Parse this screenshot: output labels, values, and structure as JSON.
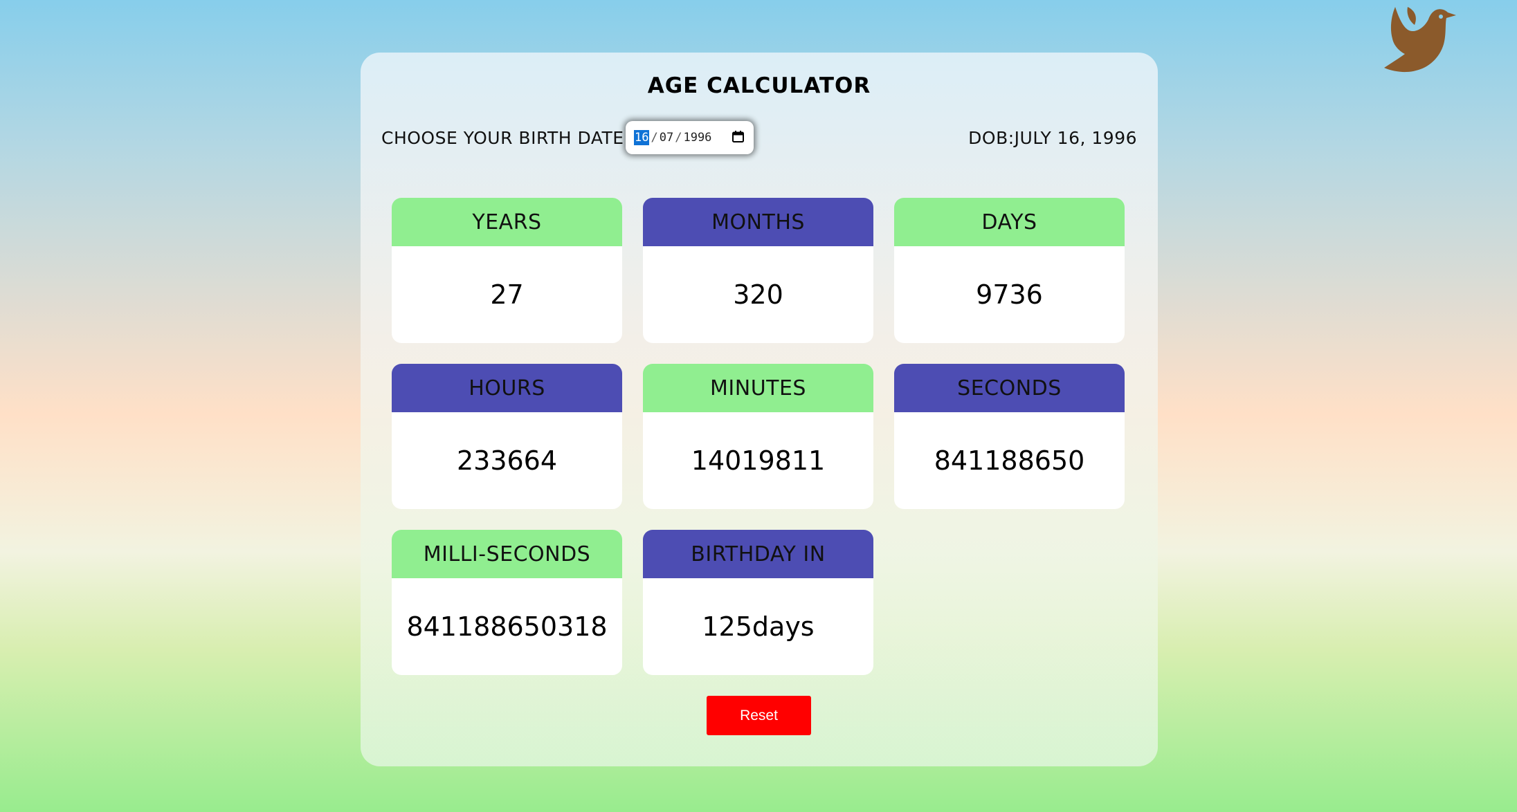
{
  "app": {
    "title": "AGE CALCULATOR"
  },
  "birth_input": {
    "label": "CHOOSE YOUR BIRTH DATE",
    "day": "16",
    "month": "07",
    "year": "1996",
    "separator": "/",
    "icon": "calendar-icon"
  },
  "dob": {
    "text": "DOB:JULY 16, 1996"
  },
  "tiles": [
    {
      "label": "YEARS",
      "value": "27",
      "color": "#90ee90"
    },
    {
      "label": "MONTHS",
      "value": "320",
      "color": "#4d4db3"
    },
    {
      "label": "DAYS",
      "value": "9736",
      "color": "#90ee90"
    },
    {
      "label": "HOURS",
      "value": "233664",
      "color": "#4d4db3"
    },
    {
      "label": "MINUTES",
      "value": "14019811",
      "color": "#90ee90"
    },
    {
      "label": "SECONDS",
      "value": "841188650",
      "color": "#4d4db3"
    },
    {
      "label": "MILLI-SECONDS",
      "value": "841188650318",
      "color": "#90ee90"
    },
    {
      "label": "BIRTHDAY IN",
      "value": "125days",
      "color": "#4d4db3"
    }
  ],
  "reset": {
    "label": "Reset",
    "color": "#ff0000"
  },
  "decor": {
    "logo_icon": "bird-icon",
    "logo_color": "#8b5a2b"
  }
}
